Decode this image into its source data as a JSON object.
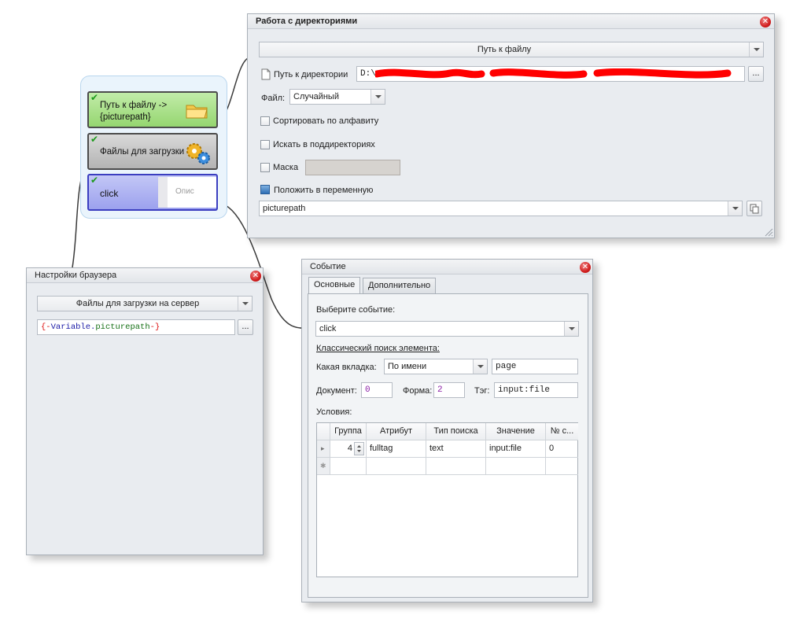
{
  "dir_window": {
    "title": "Работа с директориями",
    "action_combo": "Путь к файлу",
    "dir_label": "Путь к директории",
    "dir_value": "D:\\",
    "dots_label": "...",
    "file_label": "Файл:",
    "file_value": "Случайный",
    "sort_label": "Сортировать по алфавиту",
    "subdir_label": "Искать в поддиректориях",
    "mask_label": "Маска",
    "save_var_label": "Положить в переменную",
    "var_value": "picturepath",
    "close_glyph": "✕"
  },
  "flow": {
    "blocks": [
      {
        "label": "Путь к файлу ->\n{picturepath}",
        "color": "#a8e08c",
        "check": "✔"
      },
      {
        "label": "Файлы для загрузки",
        "color": "#c3c3c3",
        "check": "✔"
      },
      {
        "label": "click",
        "color": "#a9aef0",
        "check": "✔",
        "preview_text": "Опис"
      }
    ]
  },
  "browser_window": {
    "title": "Настройки браузера",
    "action_combo": "Файлы для загрузки на сервер",
    "var_prefix": "{-",
    "var_keyword": "Variable",
    "var_dot": ".",
    "var_name": "picturepath",
    "var_suffix": "-}",
    "dots_label": "...",
    "close_glyph": "✕"
  },
  "event_window": {
    "title": "Событие",
    "tabs": [
      {
        "label": "Основные"
      },
      {
        "label": "Дополнительно"
      }
    ],
    "choose_event_label": "Выберите событие:",
    "event_value": "click",
    "classic_search_label": "Классический поиск элемента:",
    "tab_label": "Какая вкладка:",
    "tab_mode_value": "По имени",
    "tab_name_value": "page",
    "document_label": "Документ:",
    "document_value": "0",
    "form_label": "Форма:",
    "form_value": "2",
    "tag_label": "Тэг:",
    "tag_value": "input:file",
    "conditions_label": "Условия:",
    "close_glyph": "✕",
    "grid": {
      "headers": [
        "Группа",
        "Атрибут",
        "Тип поиска",
        "Значение",
        "№ с..."
      ],
      "rows": [
        {
          "group": "4",
          "attribute": "fulltag",
          "search_type": "text",
          "value": "input:file",
          "number": "0"
        }
      ],
      "new_row_glyph": "✱",
      "current_row_glyph": "▸"
    }
  },
  "colors": {
    "accent_green": "#a8e08c",
    "accent_blue": "#a9aef0",
    "close_red": "#d21f1f",
    "redaction_red": "#ff0000"
  }
}
